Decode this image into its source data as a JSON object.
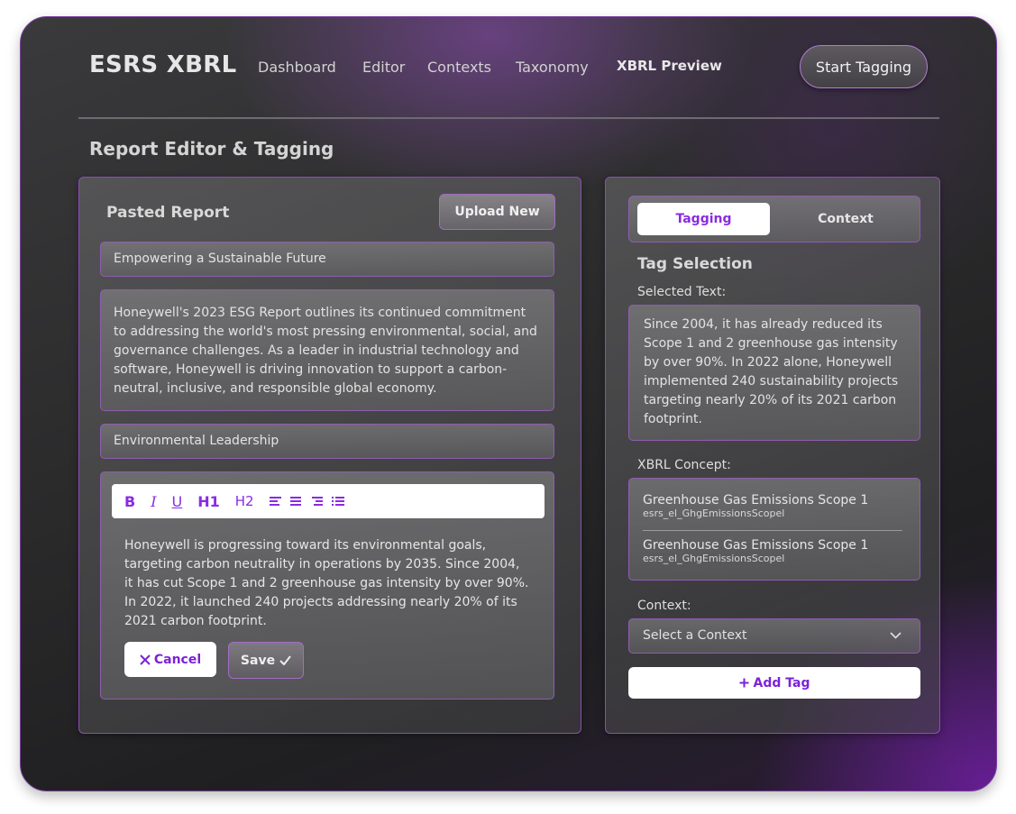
{
  "app": {
    "logo": "ESRS XBRL",
    "nav": [
      "Dashboard",
      "Editor",
      "Contexts",
      "Taxonomy",
      "XBRL Preview"
    ],
    "start_button": "Start Tagging"
  },
  "page": {
    "title": "Report Editor & Tagging"
  },
  "left": {
    "title": "Pasted Report",
    "upload_button": "Upload New",
    "sections": {
      "heading1": "Empowering a Sustainable Future",
      "para1": "Honeywell's 2023 ESG Report outlines its continued commitment to addressing the world's most pressing environmental, social, and governance challenges. As a leader in industrial technology and software, Honeywell is driving innovation to support a carbon-neutral, inclusive, and responsible global economy.",
      "heading2": "Environmental Leadership"
    },
    "editor": {
      "toolbar": {
        "bold": "B",
        "italic": "I",
        "underline": "U",
        "h1": "H1",
        "h2": "H2"
      },
      "text": "Honeywell is progressing toward its environmental goals, targeting carbon neutrality in operations by 2035. Since 2004, it has cut Scope 1 and 2 greenhouse gas intensity by over 90%. In 2022, it launched 240 projects addressing nearly 20% of its 2021 carbon footprint.",
      "cancel_label": "Cancel",
      "save_label": "Save"
    }
  },
  "right": {
    "tabs": {
      "active": "Tagging",
      "other": "Context"
    },
    "section_title": "Tag Selection",
    "selected_text_label": "Selected Text:",
    "selected_text": "Since 2004, it has already reduced its Scope 1 and 2 greenhouse gas intensity by over 90%. In 2022 alone, Honeywell implemented 240 sustainability projects targeting nearly 20% of its 2021 carbon footprint.",
    "concept_label": "XBRL Concept:",
    "concepts": [
      {
        "name": "Greenhouse Gas Emissions Scope 1",
        "code": "esrs_el_GhgEmissionsScopel"
      },
      {
        "name": "Greenhouse Gas Emissions Scope 1",
        "code": "esrs_el_GhgEmissionsScopel"
      }
    ],
    "context_label": "Context:",
    "context_select": "Select a Context",
    "add_tag_label": "Add Tag"
  },
  "colors": {
    "accent": "#8a2be2",
    "border": "#8f5db0"
  }
}
